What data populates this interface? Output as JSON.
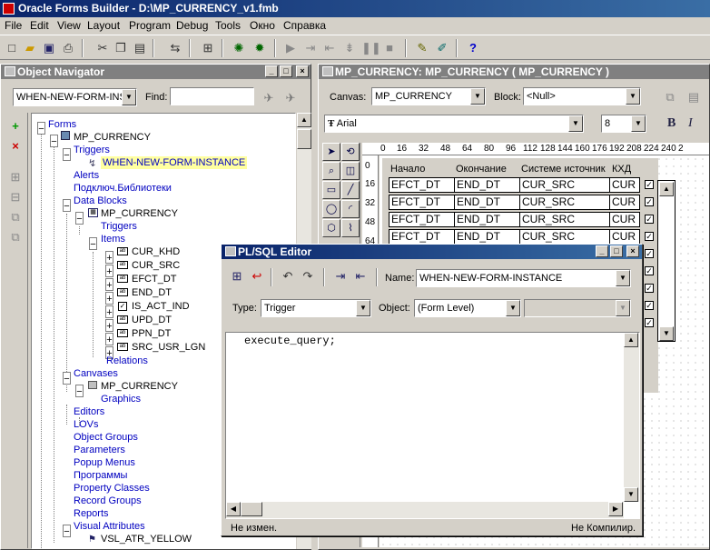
{
  "app": {
    "title": "Oracle Forms Builder - D:\\MP_CURRENCY_v1.fmb"
  },
  "menu": [
    "File",
    "Edit",
    "View",
    "Layout",
    "Program",
    "Debug",
    "Tools",
    "Окно",
    "Справка"
  ],
  "toolbar_icons": [
    "new-icon",
    "open-icon",
    "save-icon",
    "print-icon",
    "cut-icon",
    "copy-icon",
    "paste-icon",
    "revert-icon",
    "compile-icon",
    "run-form-icon",
    "debug-icon",
    "go-icon",
    "step-into-icon",
    "step-over-icon",
    "step-out-icon",
    "pause-icon",
    "stop-icon",
    "wizard-icon",
    "layout-wizard-icon",
    "help-icon"
  ],
  "navigator": {
    "title": "Object Navigator",
    "trigger_select": "WHEN-NEW-FORM-INS",
    "find_label": "Find:",
    "find_value": "",
    "tree": {
      "forms": "Forms",
      "module": "MP_CURRENCY",
      "triggers": "Triggers",
      "trigger_item": "WHEN-NEW-FORM-INSTANCE",
      "alerts": "Alerts",
      "libraries": "Подключ.Библиотеки",
      "data_blocks": "Data Blocks",
      "block": "MP_CURRENCY",
      "block_triggers": "Triggers",
      "items": "Items",
      "item_list": [
        "CUR_KHD",
        "CUR_SRC",
        "EFCT_DT",
        "END_DT",
        "IS_ACT_IND",
        "UPD_DT",
        "PPN_DT",
        "SRC_USR_LGN"
      ],
      "relations": "Relations",
      "canvases": "Canvases",
      "canvas": "MP_CURRENCY",
      "graphics": "Graphics",
      "editors": "Editors",
      "lovs": "LOVs",
      "object_groups": "Object Groups",
      "parameters": "Parameters",
      "popup_menus": "Popup Menus",
      "programs": "Программы",
      "property_classes": "Property Classes",
      "record_groups": "Record Groups",
      "reports": "Reports",
      "visual_attributes": "Visual Attributes",
      "visual_attr_item": "VSL_ATR_YELLOW"
    }
  },
  "layout_editor": {
    "title": "MP_CURRENCY: MP_CURRENCY ( MP_CURRENCY )",
    "canvas_label": "Canvas:",
    "canvas_value": "MP_CURRENCY",
    "block_label": "Block:",
    "block_value": "<Null>",
    "font_value": "Arial",
    "font_size": "8",
    "bold_label": "B",
    "italic_label": "I",
    "ruler_ticks": [
      "0",
      "16",
      "32",
      "48",
      "64",
      "80",
      "96",
      "112",
      "128",
      "144",
      "160",
      "176",
      "192",
      "208",
      "224",
      "240",
      "2"
    ],
    "vruler_ticks": [
      "0",
      "16",
      "32",
      "48",
      "64"
    ],
    "headers": [
      "Начало",
      "Окончание",
      "Системе источник",
      "КХД"
    ],
    "rows": [
      [
        "EFCT_DT",
        "END_DT",
        "CUR_SRC",
        "CUR"
      ],
      [
        "EFCT_DT",
        "END_DT",
        "CUR_SRC",
        "CUR"
      ],
      [
        "EFCT_DT",
        "END_DT",
        "CUR_SRC",
        "CUR"
      ],
      [
        "EFCT_DT",
        "END_DT",
        "CUR_SRC",
        "CUR"
      ]
    ]
  },
  "plsql_editor": {
    "title": "PL/SQL Editor",
    "name_label": "Name:",
    "name_value": "WHEN-NEW-FORM-INSTANCE",
    "type_label": "Type:",
    "type_value": "Trigger",
    "object_label": "Object:",
    "object_value": "(Form Level)",
    "object_value2": "",
    "code": "execute_query;",
    "status_left": "Не измен.",
    "status_right": "Не Компилир."
  }
}
